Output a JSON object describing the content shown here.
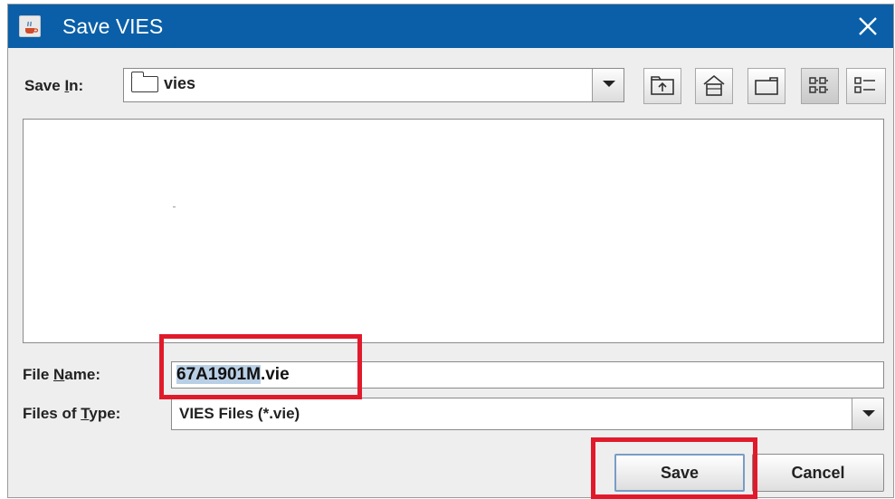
{
  "window": {
    "title": "Save VIES",
    "app_icon": "java-coffee-icon",
    "close_icon": "close-icon"
  },
  "save_in": {
    "label_prefix": "Save ",
    "label_mnemonic": "I",
    "label_suffix": "n:",
    "value": "vies",
    "value_icon": "folder-icon"
  },
  "toolbar": {
    "buttons": [
      {
        "name": "up-one-level-button",
        "icon": "up-folder-icon"
      },
      {
        "name": "home-button",
        "icon": "home-icon"
      },
      {
        "name": "new-folder-button",
        "icon": "new-folder-icon"
      },
      {
        "name": "list-view-button",
        "icon": "list-view-icon",
        "pressed": true
      },
      {
        "name": "details-view-button",
        "icon": "details-view-icon"
      }
    ]
  },
  "file_name": {
    "label_prefix": "File ",
    "label_mnemonic": "N",
    "label_suffix": "ame:",
    "value_selected": "67A1901M",
    "value_rest": ".vie"
  },
  "file_type": {
    "label_prefix": "Files of ",
    "label_mnemonic": "T",
    "label_suffix": "ype:",
    "value": "VIES Files (*.vie)"
  },
  "buttons": {
    "save": "Save",
    "cancel": "Cancel"
  },
  "colors": {
    "titlebar": "#0a5fa8",
    "highlight": "#e11a2b",
    "selection": "#b8cfe5"
  }
}
